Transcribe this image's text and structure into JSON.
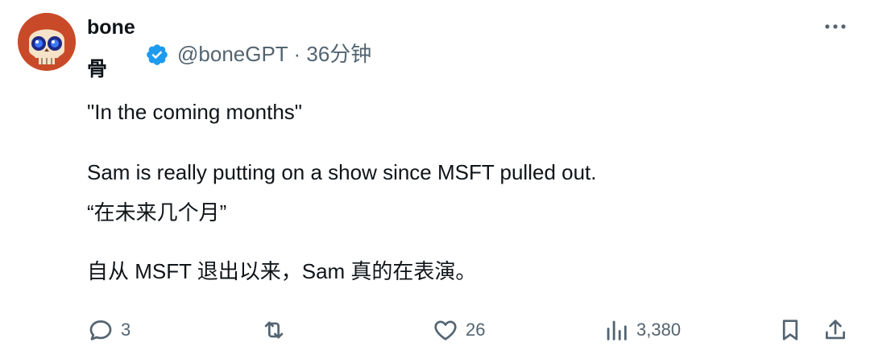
{
  "author": {
    "display_name": "bone",
    "display_name_line2": "骨",
    "handle": "@boneGPT",
    "separator": "·",
    "time": "36分钟"
  },
  "tweet": {
    "lines": [
      "\"In the coming months\"",
      "Sam is really putting on a show since MSFT pulled out.",
      "“在未来几个月”",
      "自从 MSFT 退出以来，Sam 真的在表演。"
    ]
  },
  "actions": {
    "reply_count": "3",
    "like_count": "26",
    "views_count": "3,380"
  },
  "colors": {
    "verified": "#1d9bf0",
    "muted": "#536471"
  },
  "icons": [
    "skull-avatar",
    "verified-badge-icon",
    "more-icon",
    "reply-icon",
    "retweet-icon",
    "like-icon",
    "views-icon",
    "bookmark-icon",
    "share-icon"
  ]
}
